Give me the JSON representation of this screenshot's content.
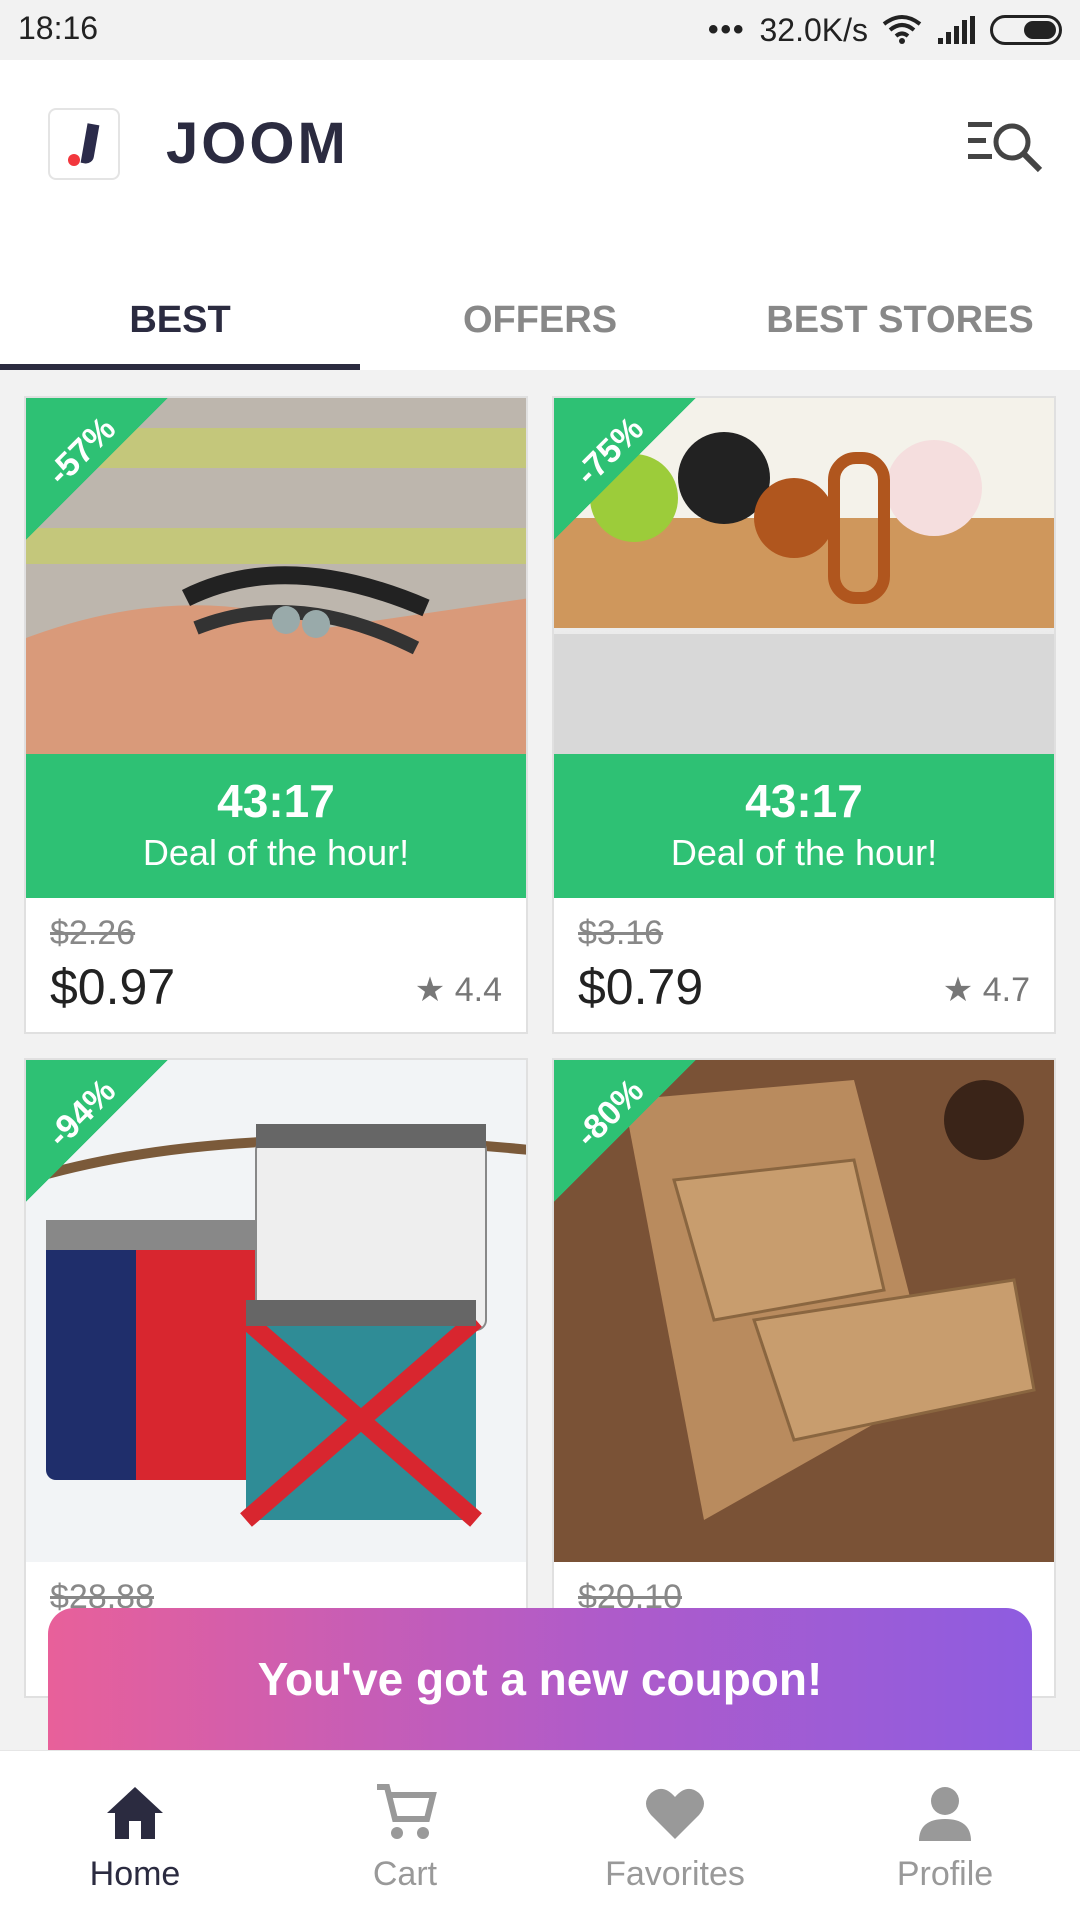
{
  "status_bar": {
    "time": "18:16",
    "network_speed": "32.0K/s"
  },
  "header": {
    "brand": "JOOM",
    "menu_search_icon": "menu-search-icon"
  },
  "tabs": [
    {
      "label": "BEST",
      "active": true
    },
    {
      "label": "OFFERS",
      "active": false
    },
    {
      "label": "BEST STORES",
      "active": false
    }
  ],
  "products": [
    {
      "discount": "-57%",
      "timer": "43:17",
      "deal_label": "Deal of the hour!",
      "old_price": "$2.26",
      "price": "$0.97",
      "rating": "4.4"
    },
    {
      "discount": "-75%",
      "timer": "43:17",
      "deal_label": "Deal of the hour!",
      "old_price": "$3.16",
      "price": "$0.79",
      "rating": "4.7"
    },
    {
      "discount": "-94%",
      "old_price": "$28.88"
    },
    {
      "discount": "-80%",
      "old_price": "$20.10"
    }
  ],
  "coupon": {
    "text": "You've got a new coupon!"
  },
  "bottom_nav": [
    {
      "label": "Home",
      "icon": "home-icon",
      "active": true
    },
    {
      "label": "Cart",
      "icon": "cart-icon",
      "active": false
    },
    {
      "label": "Favorites",
      "icon": "heart-icon",
      "active": false
    },
    {
      "label": "Profile",
      "icon": "profile-icon",
      "active": false
    }
  ],
  "colors": {
    "green": "#2ec174",
    "dark": "#2b2b40",
    "accent_red": "#f2373d"
  }
}
